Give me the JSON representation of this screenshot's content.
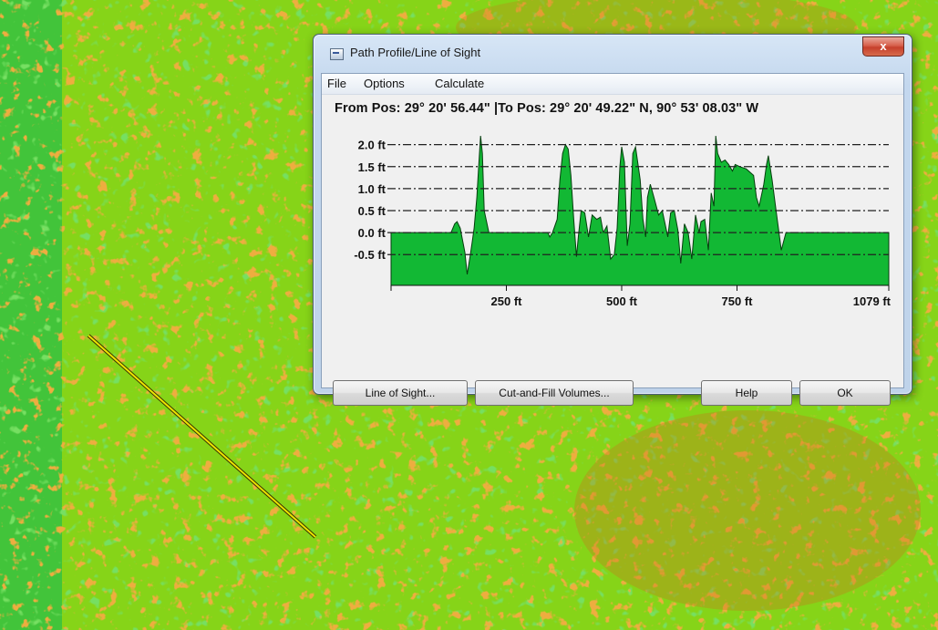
{
  "window": {
    "title": "Path Profile/Line of Sight",
    "close_glyph": "x"
  },
  "menu": {
    "items": [
      {
        "label": "File"
      },
      {
        "label": "Options"
      },
      {
        "label": "Calculate"
      }
    ]
  },
  "coords_text": "From Pos: 29° 20' 56.44\" |To Pos: 29° 20' 49.22\" N, 90° 53' 08.03\" W",
  "buttons": {
    "line_of_sight": "Line of Sight...",
    "cut_fill": "Cut-and-Fill Volumes...",
    "help": "Help",
    "ok": "OK"
  },
  "icons": {
    "app": "window-app-icon",
    "close": "close-icon"
  },
  "colors": {
    "profile_fill": "#12b834",
    "profile_stroke": "#063d0e",
    "path_line": "#ece500",
    "close_button": "#c6402c"
  },
  "chart_data": {
    "type": "area",
    "xlabel": "",
    "ylabel": "",
    "xlim": [
      0,
      1079
    ],
    "ylim": [
      -1.2,
      2.2
    ],
    "y_ticks": [
      {
        "v": 2.0,
        "label": "2.0 ft"
      },
      {
        "v": 1.5,
        "label": "1.5 ft"
      },
      {
        "v": 1.0,
        "label": "1.0 ft"
      },
      {
        "v": 0.5,
        "label": "0.5 ft"
      },
      {
        "v": 0.0,
        "label": "0.0 ft"
      },
      {
        "v": -0.5,
        "label": "-0.5 ft"
      }
    ],
    "x_ticks": [
      {
        "v": 0,
        "label": ""
      },
      {
        "v": 250,
        "label": "250 ft"
      },
      {
        "v": 500,
        "label": "500 ft"
      },
      {
        "v": 750,
        "label": "750 ft"
      },
      {
        "v": 1079,
        "label": "1079 ft"
      }
    ],
    "grid": "dash-dot horizontal",
    "series": [
      {
        "x": [
          0,
          130,
          138,
          143,
          150,
          160,
          165,
          172,
          176,
          180,
          186,
          190,
          194,
          198,
          202,
          212,
          220,
          260,
          300,
          340,
          344,
          350,
          360,
          366,
          372,
          378,
          384,
          390,
          396,
          402,
          406,
          412,
          420,
          428,
          436,
          446,
          454,
          460,
          468,
          476,
          484,
          490,
          496,
          500,
          506,
          512,
          518,
          524,
          530,
          540,
          546,
          552,
          556,
          562,
          570,
          580,
          588,
          594,
          600,
          606,
          614,
          622,
          628,
          636,
          644,
          652,
          660,
          668,
          672,
          680,
          688,
          694,
          700,
          704,
          708,
          716,
          724,
          732,
          740,
          746,
          756,
          770,
          786,
          792,
          798,
          808,
          814,
          818,
          826,
          836,
          846,
          856,
          866,
          1079
        ],
        "y": [
          0.0,
          0.0,
          0.2,
          0.25,
          0.1,
          -0.45,
          -0.95,
          -0.5,
          -0.2,
          0.1,
          0.8,
          1.5,
          2.2,
          1.8,
          0.5,
          0.0,
          0.0,
          0.0,
          0.0,
          0.0,
          -0.1,
          0.0,
          0.3,
          1.2,
          1.8,
          2.0,
          1.9,
          1.3,
          0.3,
          -0.55,
          -0.1,
          0.5,
          0.45,
          -0.1,
          0.4,
          0.3,
          0.35,
          0.0,
          0.15,
          -0.6,
          -0.5,
          0.1,
          1.5,
          1.95,
          1.6,
          -0.3,
          0.2,
          1.8,
          1.95,
          1.2,
          0.3,
          -0.1,
          0.8,
          1.1,
          0.8,
          0.4,
          0.5,
          0.2,
          -0.1,
          0.45,
          0.5,
          0.05,
          -0.7,
          0.2,
          0.0,
          -0.6,
          0.4,
          0.0,
          0.25,
          0.3,
          -0.4,
          0.9,
          0.6,
          2.2,
          1.8,
          1.6,
          1.65,
          1.55,
          1.4,
          1.55,
          1.5,
          1.45,
          1.3,
          0.8,
          0.6,
          1.1,
          1.55,
          1.75,
          1.2,
          0.4,
          -0.4,
          0.0,
          0.0,
          0.0
        ]
      }
    ]
  }
}
